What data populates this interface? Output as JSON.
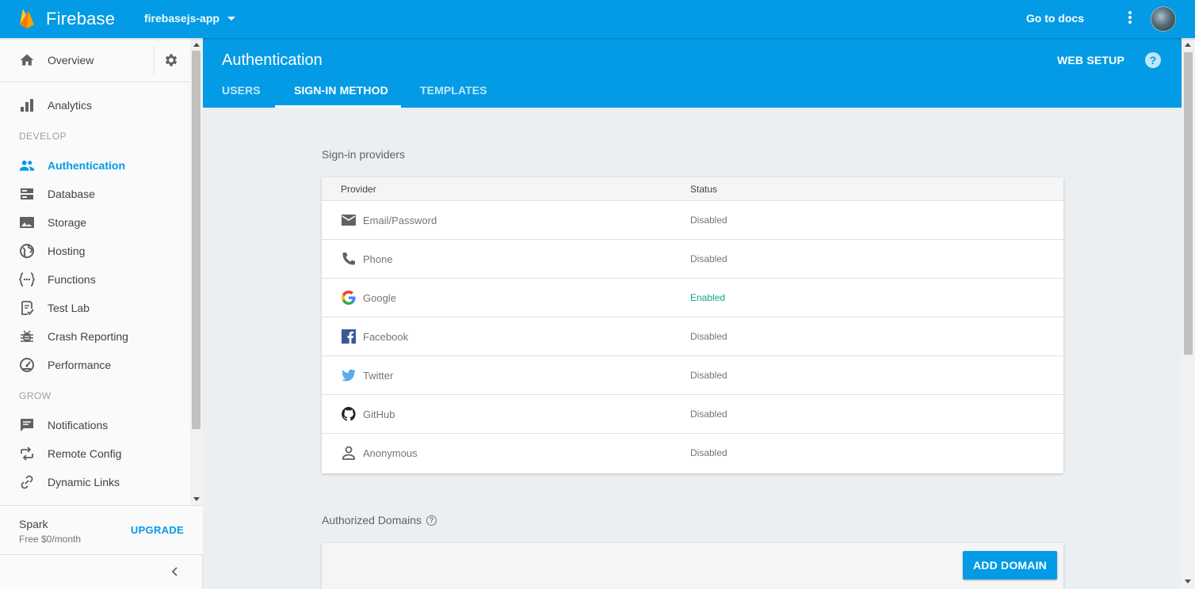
{
  "topbar": {
    "brand": "Firebase",
    "project": "firebasejs-app",
    "docs_label": "Go to docs"
  },
  "sidebar": {
    "overview": "Overview",
    "analytics": "Analytics",
    "develop_header": "DEVELOP",
    "develop_items": [
      {
        "label": "Authentication",
        "icon": "people-icon"
      },
      {
        "label": "Database",
        "icon": "database-icon"
      },
      {
        "label": "Storage",
        "icon": "image-icon"
      },
      {
        "label": "Hosting",
        "icon": "globe-icon"
      },
      {
        "label": "Functions",
        "icon": "functions-icon"
      },
      {
        "label": "Test Lab",
        "icon": "checklist-icon"
      },
      {
        "label": "Crash Reporting",
        "icon": "bug-icon"
      },
      {
        "label": "Performance",
        "icon": "speedometer-icon"
      }
    ],
    "grow_header": "GROW",
    "grow_items": [
      {
        "label": "Notifications",
        "icon": "chat-icon"
      },
      {
        "label": "Remote Config",
        "icon": "remote-config-icon"
      },
      {
        "label": "Dynamic Links",
        "icon": "link-icon"
      }
    ],
    "active": "Authentication",
    "plan": {
      "name": "Spark",
      "price": "Free $0/month",
      "upgrade": "UPGRADE"
    }
  },
  "header": {
    "title": "Authentication",
    "web_setup": "WEB SETUP",
    "help": "?",
    "tabs": [
      "USERS",
      "SIGN-IN METHOD",
      "TEMPLATES"
    ],
    "active_tab": "SIGN-IN METHOD"
  },
  "providers": {
    "section_title": "Sign-in providers",
    "columns": [
      "Provider",
      "Status"
    ],
    "rows": [
      {
        "name": "Email/Password",
        "status": "Disabled",
        "icon": "email-icon"
      },
      {
        "name": "Phone",
        "status": "Disabled",
        "icon": "phone-icon"
      },
      {
        "name": "Google",
        "status": "Enabled",
        "icon": "google-icon"
      },
      {
        "name": "Facebook",
        "status": "Disabled",
        "icon": "facebook-icon"
      },
      {
        "name": "Twitter",
        "status": "Disabled",
        "icon": "twitter-icon"
      },
      {
        "name": "GitHub",
        "status": "Disabled",
        "icon": "github-icon"
      },
      {
        "name": "Anonymous",
        "status": "Disabled",
        "icon": "person-icon"
      }
    ]
  },
  "domains": {
    "section_title": "Authorized Domains",
    "add_label": "ADD DOMAIN"
  },
  "colors": {
    "primary": "#039be5",
    "enabled": "#0ea58a"
  }
}
